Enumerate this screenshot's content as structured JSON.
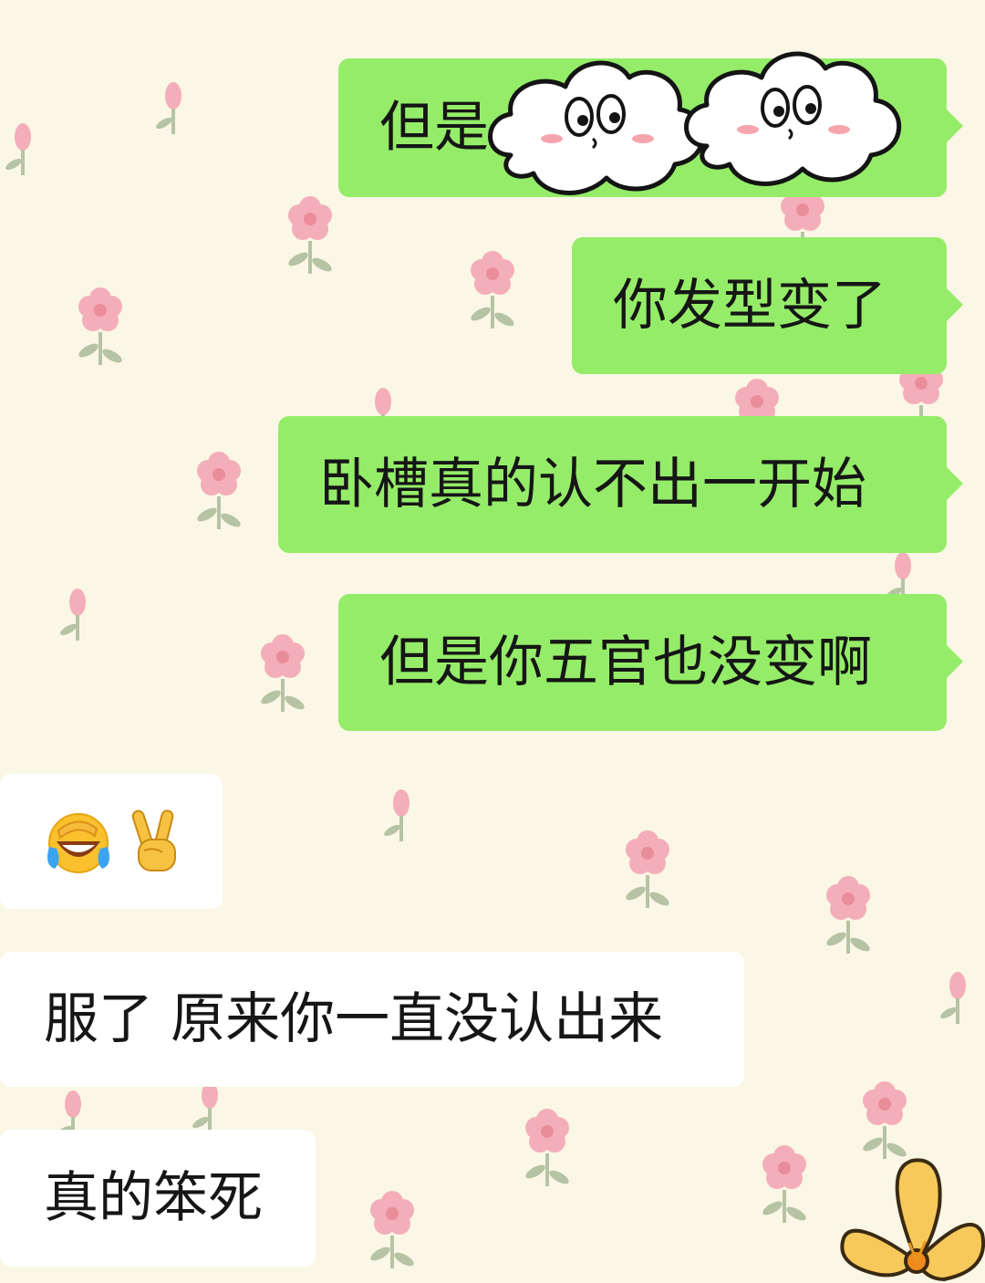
{
  "colors": {
    "background": "#fbf7e6",
    "sent_bubble": "#95ec69",
    "received_bubble": "#ffffff",
    "flower_pink": "#f3a9b4",
    "leaf_green": "#aab99a"
  },
  "messages": [
    {
      "direction": "sent",
      "text": "但是",
      "sticker": "cloud-faces-sticker"
    },
    {
      "direction": "sent",
      "text": "你发型变了"
    },
    {
      "direction": "sent",
      "text": "卧槽真的认不出一开始"
    },
    {
      "direction": "sent",
      "text": "但是你五官也没变啊"
    },
    {
      "direction": "received",
      "emojis": [
        "laughing-tears-face-icon",
        "victory-hand-icon"
      ]
    },
    {
      "direction": "received",
      "text": "服了 原来你一直没认出来"
    },
    {
      "direction": "received",
      "text": "真的笨死"
    }
  ],
  "decoration": "yellow-flower-sticker"
}
